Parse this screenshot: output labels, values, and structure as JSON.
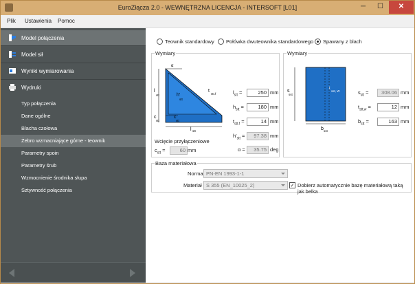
{
  "window": {
    "title": "EuroZłącza 2.0 - WEWNĘTRZNA LICENCJA - INTERSOFT [L01]"
  },
  "menu": {
    "items": [
      "Plik",
      "Ustawienia",
      "Pomoc"
    ]
  },
  "sidebar": {
    "main_items": [
      {
        "label": "Model połączenia",
        "icon": "connection-icon"
      },
      {
        "label": "Model sił",
        "icon": "forces-icon"
      },
      {
        "label": "Wyniki wymiarowania",
        "icon": "results-icon"
      },
      {
        "label": "Wydruki",
        "icon": "printer-icon"
      }
    ],
    "sub_items": [
      "Typ połączenia",
      "Dane ogólne",
      "Blacha czołowa",
      "Żebro wzmacniające górne - teownik",
      "Parametry spoin",
      "Parametry śrub",
      "Wzmocnienie środnika słupa",
      "Sztywność połączenia"
    ]
  },
  "options": {
    "radio1": "Teownik standardowy",
    "radio2": "Połówka dwuteownika standardowego",
    "radio3": "Spawany z blach",
    "selected": "radio3"
  },
  "left_group": {
    "title": "Wymiary",
    "diagram": {
      "alpha": "α",
      "l_stt": "l",
      "h_stt": "h'",
      "t_stt_f": "t",
      "c_stt": "c",
      "l_stt_b": "l",
      "sub": "stt",
      "sub_f": "stt.f"
    },
    "fields": [
      {
        "label_main": "l",
        "label_sub": "stt",
        "value": "250",
        "unit": "mm",
        "readonly": false
      },
      {
        "label_main": "h",
        "label_sub": "stt",
        "value": "180",
        "unit": "mm",
        "readonly": false
      },
      {
        "label_main": "t",
        "label_sub": "stt.f",
        "value": "14",
        "unit": "mm",
        "readonly": false
      },
      {
        "label_main": "h'",
        "label_sub": "stt",
        "value": "97.38",
        "unit": "mm",
        "readonly": true
      },
      {
        "label_main": "α",
        "label_sub": "",
        "value": "35.75",
        "unit": "deg",
        "readonly": true
      }
    ],
    "cut_title": "Wcięcie przyłączeniowe",
    "cut_label_main": "c",
    "cut_label_sub": "stt",
    "cut_value": "60",
    "cut_unit": "mm"
  },
  "right_group": {
    "title": "Wymiary",
    "diagram": {
      "s_sst": "s",
      "t_sst_w": "t",
      "b_sst": "b",
      "sub": "sst",
      "sub_w": "sst, W"
    },
    "fields": [
      {
        "label_main": "s",
        "label_sub": "stt",
        "value": "308.06",
        "unit": "mm",
        "readonly": true
      },
      {
        "label_main": "t",
        "label_sub": "stt,w",
        "value": "12",
        "unit": "mm",
        "readonly": false
      },
      {
        "label_main": "b",
        "label_sub": "stt",
        "value": "163",
        "unit": "mm",
        "readonly": false
      }
    ]
  },
  "material": {
    "title": "Baza materiałowa",
    "norma_label": "Norma",
    "norma_value": "PN-EN 1993-1-1",
    "material_label": "Materiał",
    "material_value": "S 355 (EN_10025_2)",
    "auto_label": "Dobierz automatycznie bazę materiałową taką jak belka",
    "auto_checked": true
  },
  "colors": {
    "sidebar_bg": "#4f5556",
    "diagram_blue": "#1f6fc5",
    "title_bar": "#d8ae74"
  }
}
